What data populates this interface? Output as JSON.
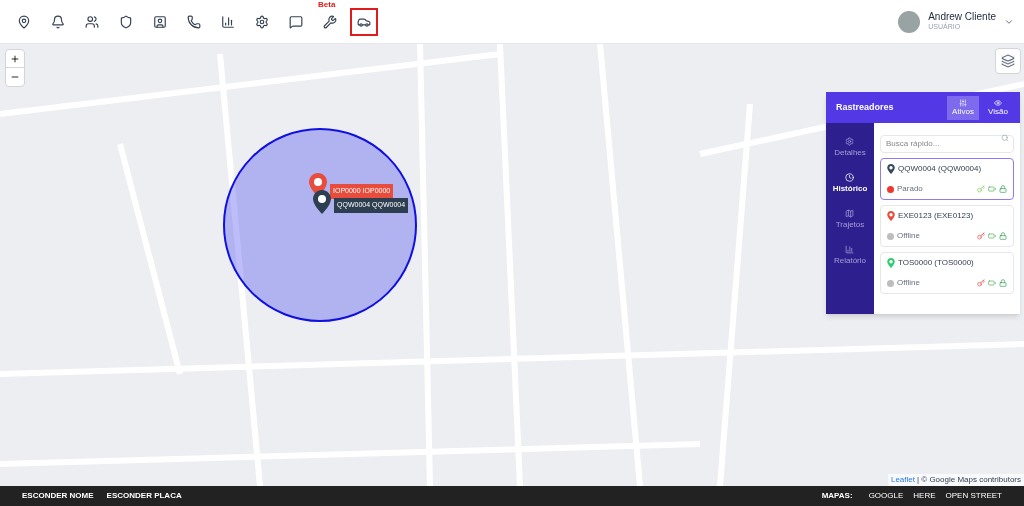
{
  "toolbar": [
    {
      "selected": false
    },
    {
      "selected": false
    },
    {
      "selected": false
    },
    {
      "selected": false
    },
    {
      "selected": false
    },
    {
      "selected": false
    },
    {
      "selected": false
    },
    {
      "selected": false
    },
    {
      "selected": false
    },
    {
      "selected": false,
      "badge": "Beta"
    },
    {
      "selected": true
    }
  ],
  "user": {
    "name": "Andrew Cliente",
    "role": "USUÁRIO"
  },
  "map": {
    "markers": [
      {
        "label": "IOP0000 IOP0000",
        "color": "#e74c3c"
      },
      {
        "label": "QQW0004 QQW0004",
        "color": "#2c3e50"
      }
    ],
    "attribution": {
      "link": "Leaflet",
      "text": "| © Google Maps contributors"
    }
  },
  "panel": {
    "title": "Rastreadores",
    "tabs": [
      {
        "label": "Ativos",
        "selected": true
      },
      {
        "label": "Visão",
        "selected": false
      }
    ],
    "nav": [
      {
        "label": "Detalhes",
        "selected": false
      },
      {
        "label": "Histórico",
        "selected": true
      },
      {
        "label": "Trajetos",
        "selected": false
      },
      {
        "label": "Relatório",
        "selected": false
      }
    ],
    "search": {
      "placeholder": "Busca rápido..."
    },
    "trackers": [
      {
        "name": "QQW0004 (QQW0004)",
        "status": "Parado",
        "color": "#34495e",
        "online": true,
        "ignition": true,
        "selected": true
      },
      {
        "name": "EXE0123 (EXE0123)",
        "status": "Offline",
        "color": "#e74c3c",
        "online": false,
        "ignition": false,
        "selected": false
      },
      {
        "name": "TOS0000 (TOS0000)",
        "status": "Offline",
        "color": "#2ecc71",
        "online": false,
        "ignition": false,
        "selected": false
      }
    ]
  },
  "footer": {
    "left": [
      "ESCONDER NOME",
      "ESCONDER PLACA"
    ],
    "maps_label": "MAPAS:",
    "maps": [
      "GOOGLE",
      "HERE",
      "OPEN STREET"
    ]
  }
}
